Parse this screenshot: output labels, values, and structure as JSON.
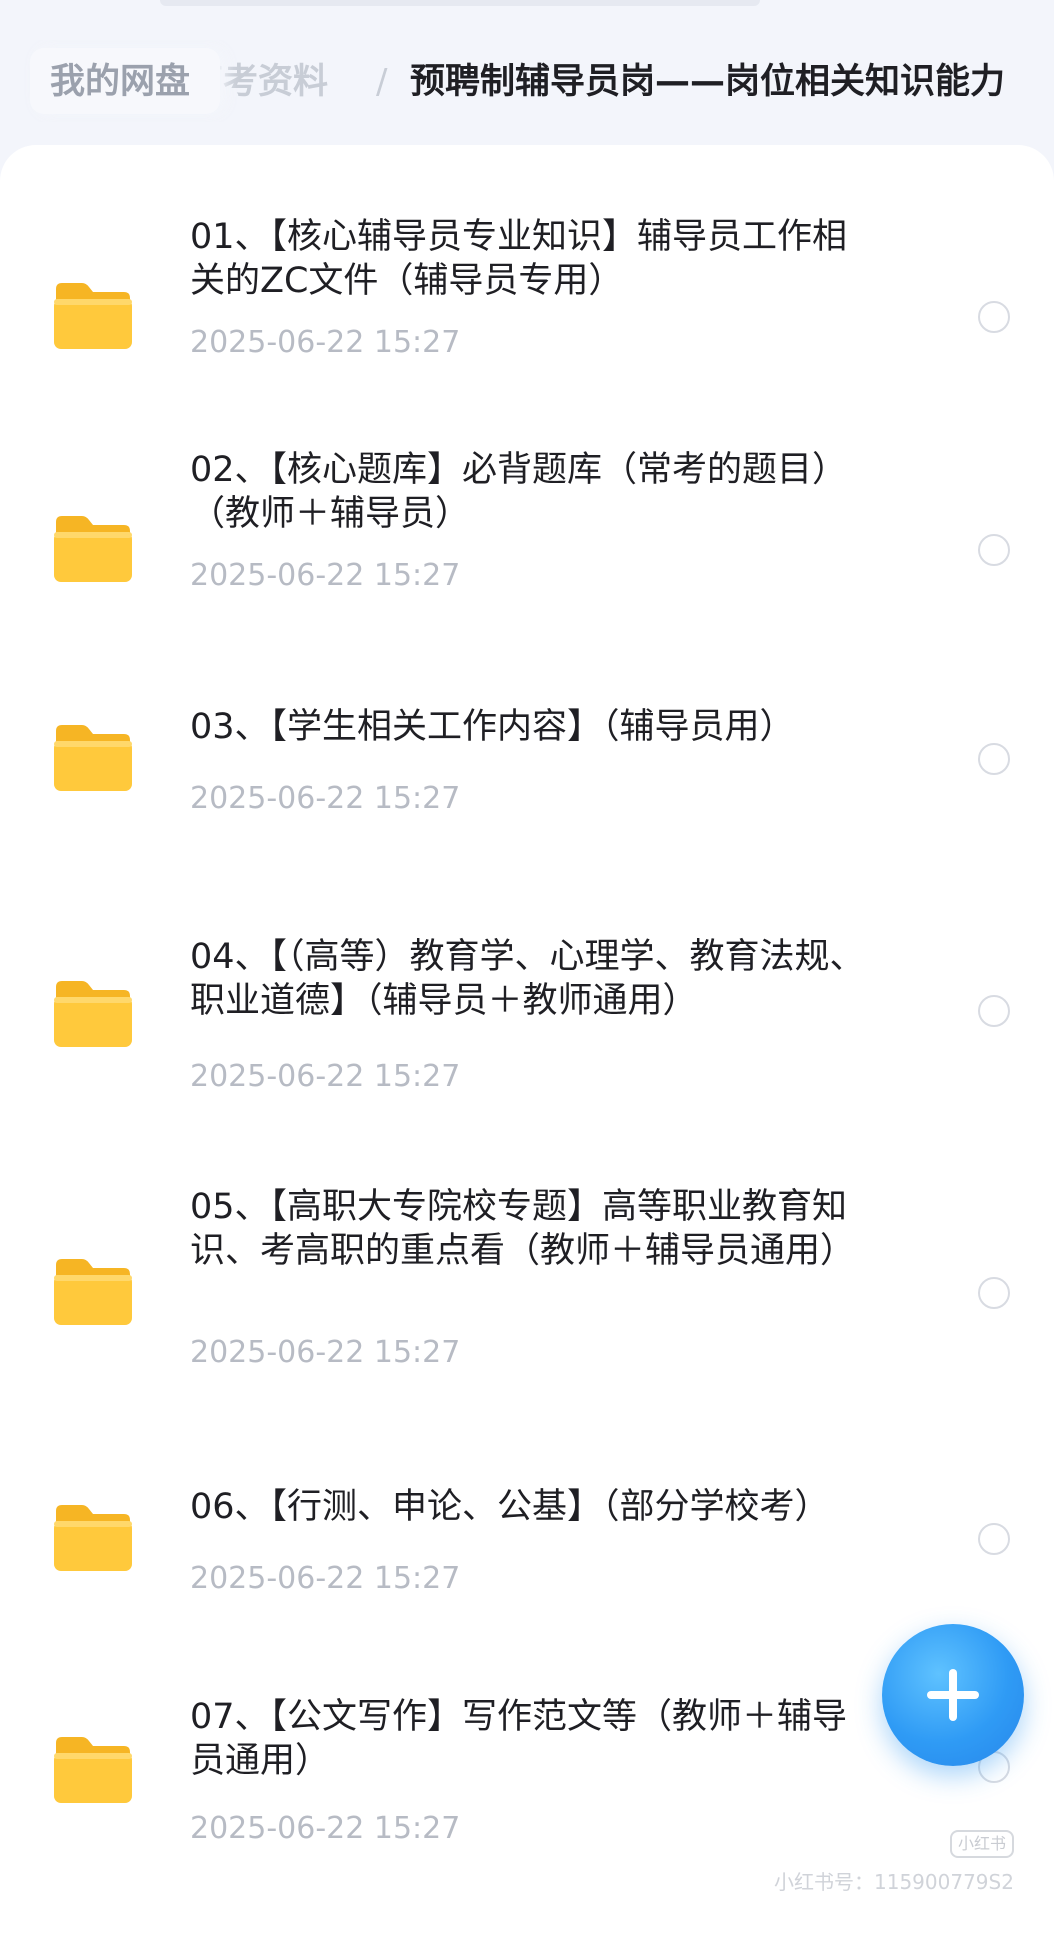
{
  "breadcrumb": {
    "root": "我的网盘",
    "middle": "育考资料",
    "separator": "/",
    "current": "预聘制辅导员岗——岗位相关知识能力"
  },
  "files": [
    {
      "name": "01、【核心辅导员专业知识】辅导员工作相关的ZC文件（辅导员专用）",
      "date": "2025-06-22 15:27",
      "icon": "folder-icon",
      "selected": false
    },
    {
      "name": "02、【核心题库】必背题库（常考的题目）（教师＋辅导员）",
      "date": "2025-06-22 15:27",
      "icon": "folder-icon",
      "selected": false
    },
    {
      "name": "03、【学生相关工作内容】（辅导员用）",
      "date": "2025-06-22 15:27",
      "icon": "folder-icon",
      "selected": false
    },
    {
      "name": "04、【（高等）教育学、心理学、教育法规、职业道德】（辅导员＋教师通用）",
      "date": "2025-06-22 15:27",
      "icon": "folder-icon",
      "selected": false
    },
    {
      "name": "05、【高职大专院校专题】高等职业教育知识、考高职的重点看（教师＋辅导员通用）",
      "date": "2025-06-22 15:27",
      "icon": "folder-icon",
      "selected": false
    },
    {
      "name": "06、【行测、申论、公基】（部分学校考）",
      "date": "2025-06-22 15:27",
      "icon": "folder-icon",
      "selected": false
    },
    {
      "name": "07、【公文写作】写作范文等（教师＋辅导员通用）",
      "date": "2025-06-22 15:27",
      "icon": "folder-icon",
      "selected": false
    }
  ],
  "fab": {
    "icon": "plus-icon"
  },
  "watermark": {
    "text": "小红书号：115900779S2",
    "badge": "小红书"
  },
  "colors": {
    "accent": "#2f9bf5",
    "folder": "#ffc93c",
    "background": "#f3f5fb",
    "date_text": "#b7bbc4"
  }
}
